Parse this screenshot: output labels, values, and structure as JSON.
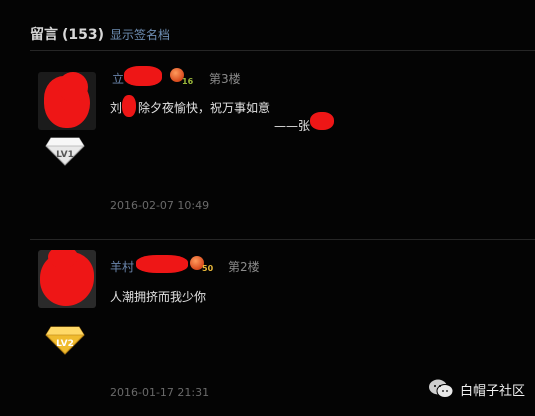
{
  "header": {
    "title": "留言",
    "count": "(153)",
    "toggle_link": "显示签名档"
  },
  "comments": [
    {
      "author": "立",
      "level_num": "16",
      "floor": "第3楼",
      "text_a": "刘",
      "text_b": "除夕夜愉快，祝万事如意",
      "sign": "——张",
      "badge": "LV1",
      "badge_color": "#d8d8d8",
      "time": "2016-02-07 10:49"
    },
    {
      "author": "羊村",
      "level_num": "50",
      "floor": "第2楼",
      "text_a": "人潮拥挤而我少你",
      "badge": "LV2",
      "badge_color": "#e6b22a",
      "time": "2016-01-17 21:31"
    }
  ],
  "watermark": {
    "text": "白帽子社区",
    "icon": "wechat-icon"
  },
  "colors": {
    "background": "#040404",
    "link": "#6b86ad",
    "redaction": "#ee1616"
  }
}
